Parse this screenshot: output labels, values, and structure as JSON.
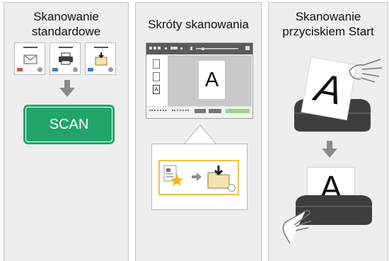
{
  "panels": [
    {
      "title_line1": "Skanowanie",
      "title_line2": "standardowe",
      "button_label": "SCAN"
    },
    {
      "title": "Skróty skanowania",
      "document_letter": "A"
    },
    {
      "title_line1": "Skanowanie",
      "title_line2": "przyciskiem Start",
      "document_letter_top": "A",
      "document_letter_bottom": "A"
    }
  ],
  "colors": {
    "scan_button": "#22a46b",
    "shortcut_border": "#f1c14b",
    "star": "#f5b400",
    "arrow": "#8b8b8b"
  },
  "icons": [
    "mail-icon",
    "printer-icon",
    "folder-icon",
    "down-arrow-icon",
    "star-icon",
    "right-arrow-icon",
    "hand-icon",
    "scanner-icon"
  ]
}
